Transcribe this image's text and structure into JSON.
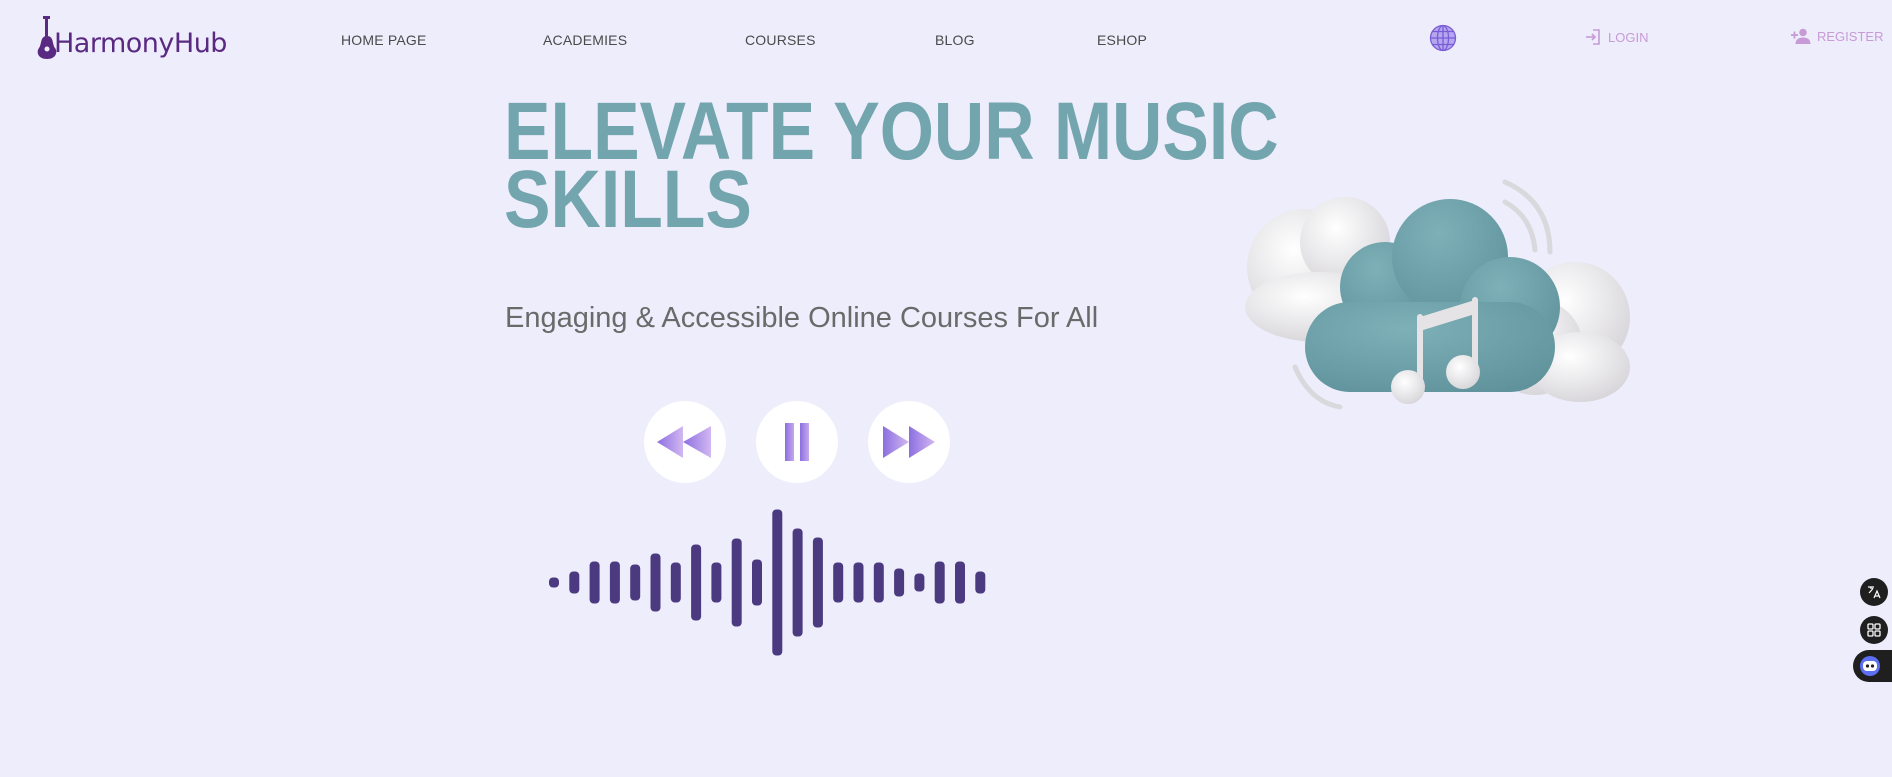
{
  "brand": {
    "name": "HarmonyHub",
    "color": "#5a2a82"
  },
  "nav": {
    "items": [
      {
        "label": "HOME PAGE"
      },
      {
        "label": "ACADEMIES"
      },
      {
        "label": "COURSES"
      },
      {
        "label": "BLOG"
      },
      {
        "label": "ESHOP"
      }
    ]
  },
  "auth": {
    "login_label": "LOGIN",
    "register_label": "REGISTER",
    "color": "#c79bd6"
  },
  "hero": {
    "title_line1": "ELEVATE YOUR MUSIC",
    "title_line2": "SKILLS",
    "subtitle": "Engaging & Accessible Online Courses For All",
    "title_color": "#72a5ad"
  },
  "player": {
    "controls": [
      "rewind-icon",
      "pause-icon",
      "fast-forward-icon"
    ],
    "accent": "#9b7fe0",
    "wave_color": "#4b3a80"
  },
  "illustration": {
    "icon": "cloud-music-note-icon",
    "cloud_color": "#6b9ea6"
  },
  "side_tools": [
    "translate-icon",
    "apps-grid-icon",
    "assistant-bot-icon"
  ]
}
